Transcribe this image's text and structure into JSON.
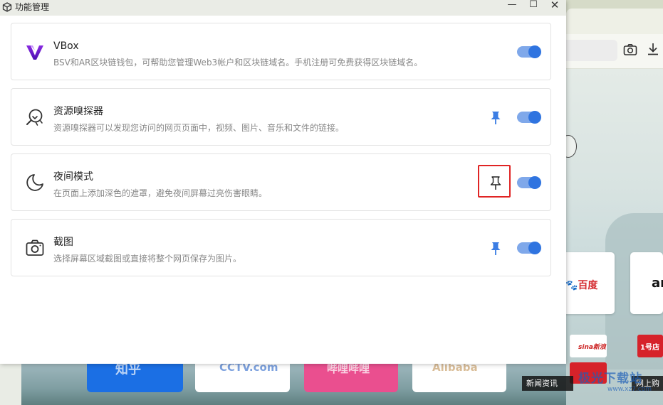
{
  "window": {
    "title": "功能管理",
    "minimize_glyph": "—",
    "maximize_glyph": "☐",
    "close_glyph": "✕"
  },
  "features": [
    {
      "title": "VBox",
      "description": "BSV和AR区块链钱包，可帮助您管理Web3帐户和区块链域名。手机注册可免费获得区块链域名。",
      "icon": "vbox-logo-icon",
      "pinned": false,
      "enabled": true
    },
    {
      "title": "资源嗅探器",
      "description": "资源嗅探器可以发现您访问的网页页面中，视频、图片、音乐和文件的链接。",
      "icon": "sniffer-icon",
      "pinned": true,
      "enabled": true
    },
    {
      "title": "夜间模式",
      "description": "在页面上添加深色的遮罩，避免夜间屏幕过亮伤害眼睛。",
      "icon": "moon-icon",
      "pinned": false,
      "highlighted": true,
      "enabled": true
    },
    {
      "title": "截图",
      "description": "选择屏幕区域截图或直接将整个网页保存为图片。",
      "icon": "camera-icon",
      "pinned": true,
      "enabled": true
    }
  ],
  "background": {
    "tile_baidu": "百度",
    "tile_amazon": "an",
    "tile_sina": "sina新浪",
    "tile_red": "1号店",
    "tile_zhihu": "知乎",
    "tile_w1": "CCTV.com",
    "tile_pink": "哔哩哔哩",
    "tile_w2": "Alibaba",
    "caption_news": "新闻资讯",
    "caption_shop": "网上购",
    "watermark": "极光下载站",
    "watermark_sub": "www.xz7.com"
  },
  "colors": {
    "accent": "#2f74e0",
    "pin_blue": "#3b7de4",
    "highlight_red": "#e02424",
    "vbox_purple": "#6a1fd1"
  }
}
